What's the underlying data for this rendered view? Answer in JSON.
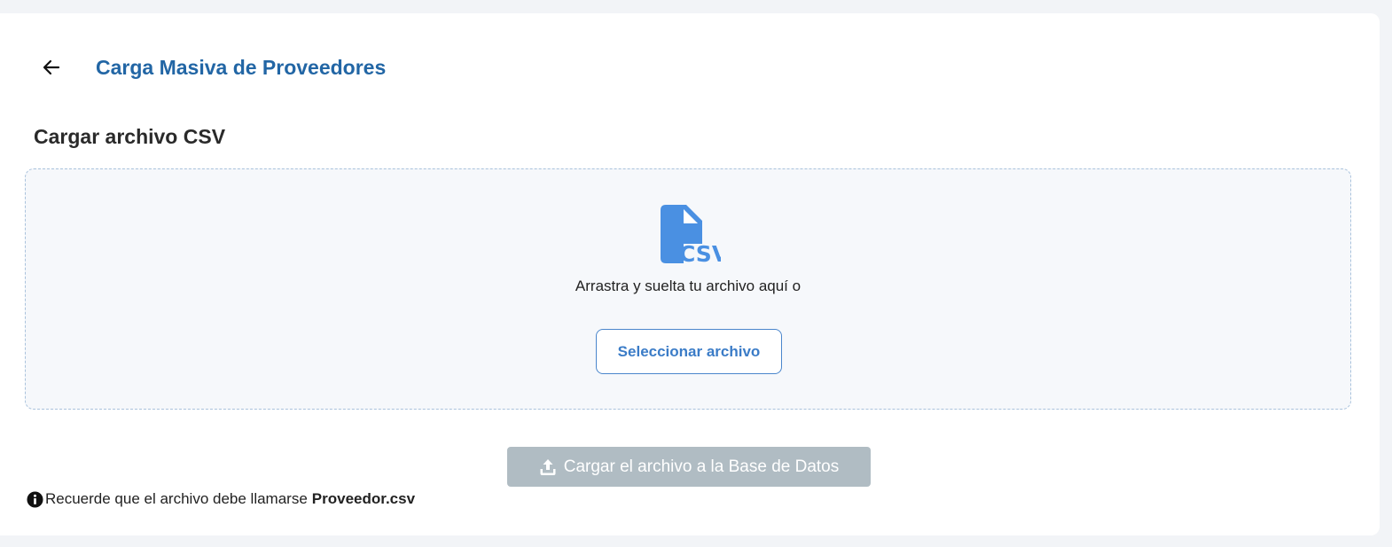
{
  "header": {
    "back_icon": "arrow-left-icon",
    "title": "Carga Masiva de Proveedores"
  },
  "upload_section": {
    "title": "Cargar archivo CSV",
    "dropzone": {
      "icon": "csv-file-icon",
      "icon_color": "#4a90e2",
      "instruction": "Arrastra y suelta tu archivo aquí o",
      "select_button_label": "Seleccionar archivo"
    },
    "upload_button": {
      "icon": "upload-icon",
      "label": "Cargar el archivo a la Base de Datos",
      "state": "disabled"
    },
    "note": {
      "icon": "info-circle-icon",
      "text": "Recuerde que el archivo debe llamarse",
      "filename": "Proveedor.csv"
    }
  },
  "colors": {
    "accent": "#2266a5",
    "button_outline": "#4a86cc",
    "disabled_button": "#b0bcc3",
    "dropzone_border": "#a9c2dc"
  }
}
